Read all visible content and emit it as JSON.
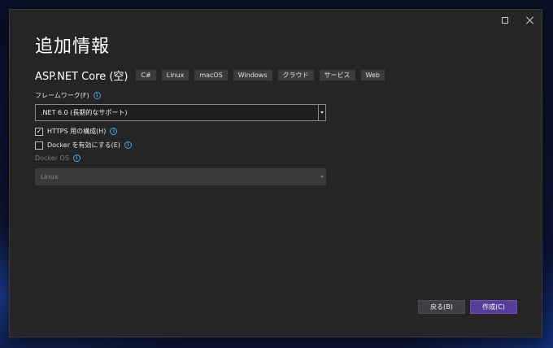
{
  "dialog": {
    "title": "追加情報",
    "template_name": "ASP.NET Core (空)",
    "tags": [
      "C#",
      "Linux",
      "macOS",
      "Windows",
      "クラウド",
      "サービス",
      "Web"
    ]
  },
  "framework": {
    "label": "フレームワーク(F)",
    "selected": ".NET 6.0 (長期的なサポート)"
  },
  "https": {
    "label": "HTTPS 用の構成(H)",
    "checked": true,
    "check_glyph": "✓"
  },
  "docker": {
    "label": "Docker を有効にする(E)",
    "checked": false
  },
  "docker_os": {
    "label": "Docker OS",
    "selected": "Linux",
    "enabled": false
  },
  "buttons": {
    "back": "戻る(B)",
    "create": "作成(C)"
  },
  "icons": {
    "info": "i"
  },
  "colors": {
    "accent": "#5a3d98",
    "dialog_bg": "#252526",
    "info": "#4aa3df"
  }
}
